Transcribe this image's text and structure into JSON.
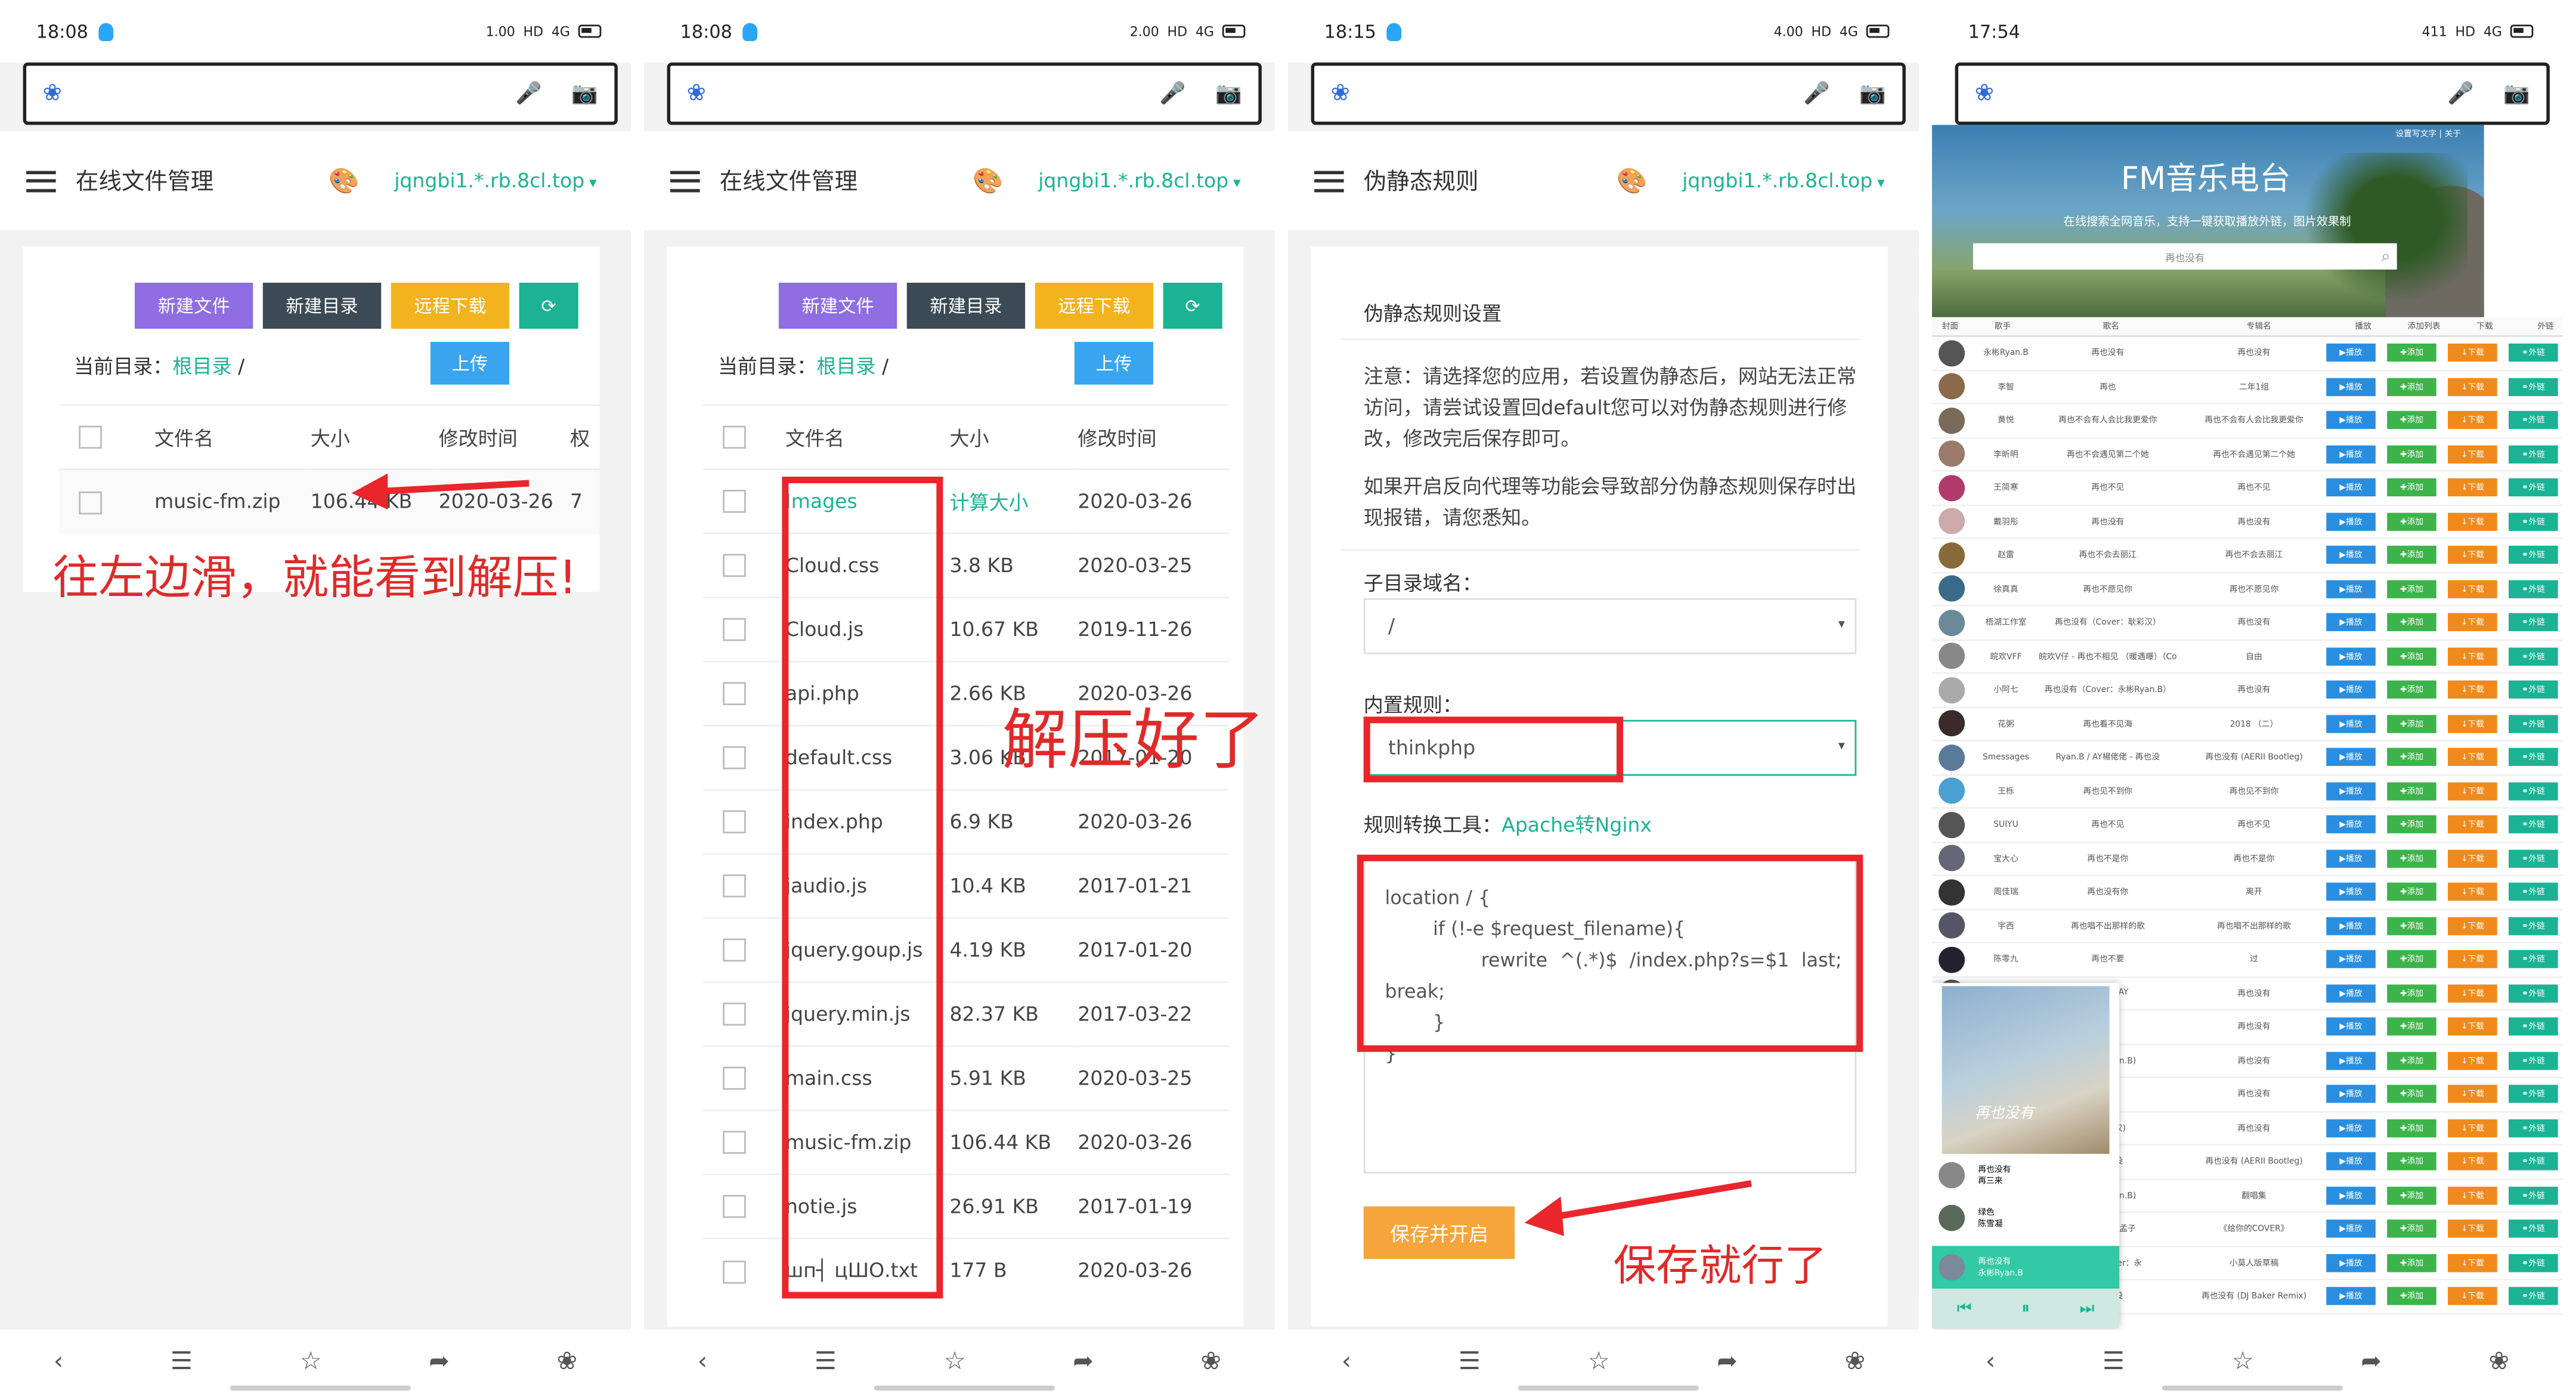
{
  "phones": [
    {
      "time": "18:08",
      "net": "1.00",
      "title": "在线文件管理",
      "domain": "jqngbi1.*.rb.8cl.top"
    },
    {
      "time": "18:08",
      "net": "2.00",
      "title": "在线文件管理",
      "domain": "jqngbi1.*.rb.8cl.top"
    },
    {
      "time": "18:15",
      "net": "4.00",
      "title": "伪静态规则",
      "domain": "jqngbi1.*.rb.8cl.top"
    },
    {
      "time": "17:54",
      "net": "411"
    }
  ],
  "status": {
    "hd": "HD",
    "sig": "4G"
  },
  "toolbar": {
    "new_file": "新建文件",
    "new_dir": "新建目录",
    "remote": "远程下载",
    "refresh": "⟳",
    "upload": "上传"
  },
  "dir": {
    "label": "当前目录：",
    "root": "根目录",
    "sep": "/"
  },
  "cols": {
    "name": "文件名",
    "size": "大小",
    "mtime": "修改时间",
    "extra": "权"
  },
  "p1row": {
    "name": "music-fm.zip",
    "size": "106.44 KB",
    "mtime": "2020-03-26",
    "extra": "7"
  },
  "p1note": "往左边滑，就能看到解压!",
  "files": [
    {
      "name": "Images",
      "size": "计算大小",
      "mtime": "2020-03-26"
    },
    {
      "name": "Cloud.css",
      "size": "3.8 KB",
      "mtime": "2020-03-25"
    },
    {
      "name": "Cloud.js",
      "size": "10.67 KB",
      "mtime": "2019-11-26"
    },
    {
      "name": "api.php",
      "size": "2.66 KB",
      "mtime": "2020-03-26"
    },
    {
      "name": "default.css",
      "size": "3.06 KB",
      "mtime": "2017-01-20"
    },
    {
      "name": "index.php",
      "size": "6.9 KB",
      "mtime": "2020-03-26"
    },
    {
      "name": "jaudio.js",
      "size": "10.4 KB",
      "mtime": "2017-01-21"
    },
    {
      "name": "jquery.goup.js",
      "size": "4.19 KB",
      "mtime": "2017-01-20"
    },
    {
      "name": "jquery.min.js",
      "size": "82.37 KB",
      "mtime": "2017-03-22"
    },
    {
      "name": "main.css",
      "size": "5.91 KB",
      "mtime": "2020-03-25"
    },
    {
      "name": "music-fm.zip",
      "size": "106.44 KB",
      "mtime": "2020-03-26"
    },
    {
      "name": "notie.js",
      "size": "26.91 KB",
      "mtime": "2017-01-19"
    },
    {
      "name": "шп┤ цШО.txt",
      "size": "177 B",
      "mtime": "2020-03-26"
    }
  ],
  "p2note": "解压好了",
  "rw": {
    "heading": "伪静态规则设置",
    "notice": "注意：请选择您的应用，若设置伪静态后，网站无法正常访问，请尝试设置回default您可以对伪静态规则进行修改，修改完后保存即可。",
    "notice2": "如果开启反向代理等功能会导致部分伪静态规则保存时出现报错，请您悉知。",
    "subdomain_label": "子目录域名：",
    "subdomain_value": "/",
    "builtin_label": "内置规则：",
    "builtin_value": "thinkphp",
    "conv_label": "规则转换工具：",
    "conv_link": "Apache转Nginx",
    "code": [
      "location / {",
      "        if (!-e $request_filename){",
      "                rewrite  ^(.*)$  /index.php?s=$1  last;",
      "break;",
      "        }",
      "}"
    ],
    "save": "保存并开启",
    "note": "保存就行了"
  },
  "fm": {
    "title": "FM音乐电台",
    "sub": "在线搜索全网音乐，支持一键获取播放外链，图片效果制",
    "search": "再也没有",
    "toplink": "设置写文字 | 关于",
    "head": [
      "封面",
      "歌手",
      "歌名",
      "专辑名",
      "播放",
      "添加列表",
      "下载",
      "外链"
    ],
    "rows": [
      {
        "a": "永彬Ryan.B",
        "s": "再也没有",
        "al": "再也没有"
      },
      {
        "a": "李智",
        "s": "再也",
        "al": "二年1组"
      },
      {
        "a": "黄悦",
        "s": "再也不会有人会比我更爱你",
        "al": "再也不会有人会比我更爱你"
      },
      {
        "a": "李昕明",
        "s": "再也不会遇见第二个她",
        "al": "再也不会遇见第二个她"
      },
      {
        "a": "王简寒",
        "s": "再也不见",
        "al": "再也不见"
      },
      {
        "a": "戴羽彤",
        "s": "再也没有",
        "al": "再也没有"
      },
      {
        "a": "赵雷",
        "s": "再也不会去丽江",
        "al": "再也不会去丽江"
      },
      {
        "a": "徐真真",
        "s": "再也不愿见你",
        "al": "再也不愿见你"
      },
      {
        "a": "梧湖工作室",
        "s": "再也没有（Cover：耿彩汉）",
        "al": "再也没有"
      },
      {
        "a": "皖欢VFF",
        "s": "皖欢V仔 - 再也不相见 （暖遇曝）（Co",
        "al": "自由"
      },
      {
        "a": "小阿七",
        "s": "再也没有（Cover：永彬Ryan.B）",
        "al": "再也没有"
      },
      {
        "a": "花粥",
        "s": "再也看不见海",
        "al": "2018 （二）"
      },
      {
        "a": "Smessages",
        "s": "Ryan.B / AY楊佬佬 - 再也没",
        "al": "再也没有 (AERII Bootleg)"
      },
      {
        "a": "王栎",
        "s": "再也见不到你",
        "al": "再也见不到你"
      },
      {
        "a": "SUIYU",
        "s": "再也不见",
        "al": "再也不见"
      },
      {
        "a": "宝大心",
        "s": "再也不是你",
        "al": "再也不是你"
      },
      {
        "a": "周佳瑞",
        "s": "再也没有你",
        "al": "离开"
      },
      {
        "a": "宇西",
        "s": "再也唱不出那样的歌",
        "al": "再也唱不出那样的歌"
      },
      {
        "a": "陈零九",
        "s": "再也不要",
        "al": "过"
      },
      {
        "a": "",
        "s": "Ryan.B/AY",
        "al": "再也没有"
      },
      {
        "a": "",
        "s": "没有",
        "al": "再也没有"
      },
      {
        "a": "",
        "s": "：永彬Ryan.B)",
        "al": "再也没有"
      },
      {
        "a": "",
        "s": "没有",
        "al": "再也没有"
      },
      {
        "a": "",
        "s": "：耿彩汉)",
        "al": "再也没有"
      },
      {
        "a": "",
        "s": "- 再也没",
        "al": "再也没有 (AERII Bootleg)"
      },
      {
        "a": "",
        "s": "：永彬Ryan.B)",
        "al": "翻唱集"
      },
      {
        "a": "",
        "s": "：Ryan.B/孟子",
        "al": "《给你的COVER》"
      },
      {
        "a": "",
        "s": "人故）(Cover：永",
        "al": "小莫人版草稿"
      },
      {
        "a": "",
        "s": "- 再也没",
        "al": "再也没有 (DJ Baker Remix)"
      }
    ],
    "btn": {
      "play": "▶播放",
      "add": "✚添加",
      "dl": "↓下载",
      "link": "⚭外链"
    },
    "player": {
      "song1": "绿色",
      "artist1": "陈雪凝",
      "now": "再也没有",
      "now_artist": "永彬Ryan.B",
      "cover_text": "再也没有",
      "sub": "再三来"
    }
  },
  "colors": {
    "teal": "#1bb394",
    "red": "#e8262c",
    "orange": "#f5a53b"
  }
}
